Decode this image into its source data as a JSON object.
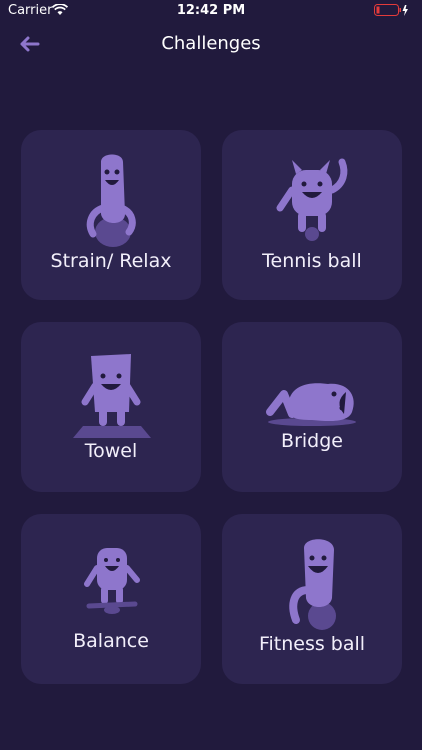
{
  "status": {
    "carrier": "Carrier",
    "time": "12:42 PM"
  },
  "nav": {
    "title": "Challenges"
  },
  "colors": {
    "background": "#211a3d",
    "card": "#2d2550",
    "accent": "#8e76cc",
    "accent_dark": "#5a4990",
    "battery": "#e33b3b"
  },
  "challenges": [
    {
      "label": "Strain/ Relax",
      "icon": "character-on-ball-icon"
    },
    {
      "label": "Tennis ball",
      "icon": "monster-with-tennis-ball-icon"
    },
    {
      "label": "Towel",
      "icon": "character-on-towel-icon"
    },
    {
      "label": "Bridge",
      "icon": "character-bridge-pose-icon"
    },
    {
      "label": "Balance",
      "icon": "character-balance-board-icon"
    },
    {
      "label": "Fitness ball",
      "icon": "character-on-fitness-ball-icon"
    }
  ]
}
